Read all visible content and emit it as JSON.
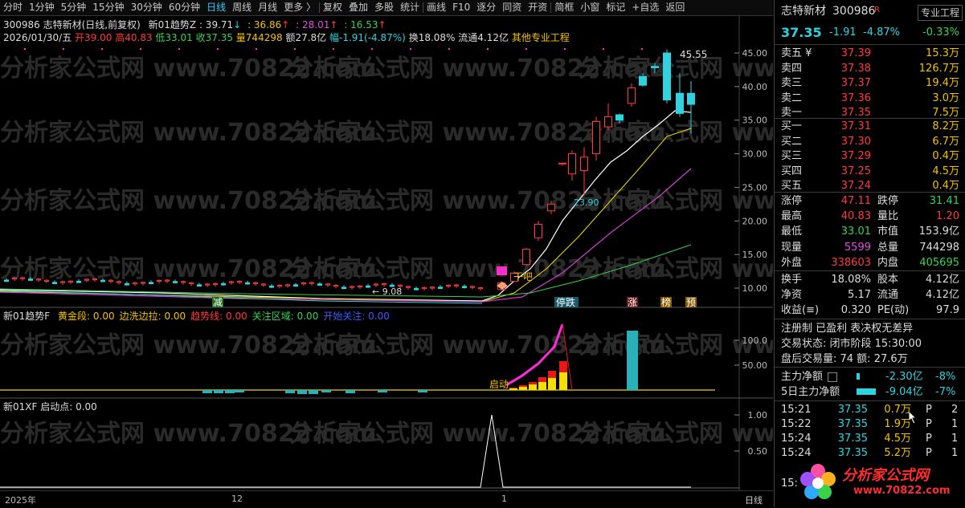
{
  "toolbar": {
    "items": [
      "分时",
      "1分钟",
      "5分钟",
      "15分钟",
      "30分钟",
      "60分钟",
      "日线",
      "周线",
      "月线",
      "更多 〉",
      "复权",
      "叠加",
      "多股",
      "统计",
      "画线",
      "F10",
      "逐分",
      "同资",
      "开资",
      "简框",
      "小窗",
      "标记",
      "+自选",
      "返回"
    ],
    "active": "日线"
  },
  "chart": {
    "header1": {
      "code_name": "300986 志特新材(日线,前复权)",
      "indicator": "新01趋势Z : 39.71",
      "v2": ": 36.86",
      "v3": ": 28.01",
      "v4": ": 16.53"
    },
    "header2": {
      "date": "2026/01/30/五",
      "open": "开39.00",
      "high": "高40.83",
      "low": "低33.01",
      "close": "收37.35",
      "vol": "量744298",
      "amount": "额27.8亿",
      "change": "幅-1.91(-4.87%)",
      "turnover": "换18.08%",
      "float": "流通4.12亿",
      "sector": "其他专业工程"
    },
    "price_axis": [
      "45.00",
      "40.00",
      "35.00",
      "30.00",
      "25.00",
      "20.00",
      "15.00",
      "10.00"
    ],
    "annotations": {
      "high_mark": "45.55",
      "low_mark": "← 9.08",
      "mid_mark": "23.90",
      "gan_label": "干吧",
      "jian_label": "减",
      "tingdie_label": "停跌",
      "zhang": "涨",
      "bang": "榜",
      "yu": "预"
    },
    "sub1": {
      "title": "新01趋势F",
      "labels": [
        {
          "text": "黄金段: 0.00",
          "color": "#f3c200"
        },
        {
          "text": "边洗边拉: 0.00",
          "color": "#f3c200"
        },
        {
          "text": "趋势线: 0.00",
          "color": "#ff3b3b"
        },
        {
          "text": "关注区域: 0.00",
          "color": "#39d353"
        },
        {
          "text": "开始关注: 0.00",
          "color": "#3c5cff"
        }
      ],
      "axis": [
        "100.0",
        "50.00"
      ],
      "start_label": "启动"
    },
    "sub2": {
      "title": "新01XF 启动点: 0.00",
      "axis": [
        "1.00",
        "0.50"
      ]
    },
    "time_axis": [
      "2025年",
      "12",
      "1"
    ],
    "period": "日线",
    "watermark": "分析家公式网 www.70822.com"
  },
  "panel": {
    "name": "志特新材",
    "code": "300986",
    "r_badge": "R",
    "pro_btn": "专业工程",
    "price": "37.35",
    "change": "-1.91",
    "pct": "-4.87%",
    "sector_pct": "-0.33%",
    "sells": [
      {
        "label": "卖五 ¥",
        "price": "37.39",
        "vol": "15.3万"
      },
      {
        "label": "卖四",
        "price": "37.38",
        "vol": "126.7万"
      },
      {
        "label": "卖三",
        "price": "37.37",
        "vol": "19.4万"
      },
      {
        "label": "卖二",
        "price": "37.36",
        "vol": "3.0万"
      },
      {
        "label": "卖一",
        "price": "37.35",
        "vol": "7.5万"
      }
    ],
    "buys": [
      {
        "label": "买一",
        "price": "37.31",
        "vol": "8.2万"
      },
      {
        "label": "买二",
        "price": "37.30",
        "vol": "6.7万"
      },
      {
        "label": "买三",
        "price": "37.29",
        "vol": "0.4万"
      },
      {
        "label": "买四",
        "price": "37.25",
        "vol": "4.5万"
      },
      {
        "label": "买五",
        "price": "37.24",
        "vol": "0.4万"
      }
    ],
    "stats1": [
      {
        "l1": "涨停",
        "v1": "47.11",
        "c1": "red",
        "l2": "跌停",
        "v2": "31.41",
        "c2": "grn"
      },
      {
        "l1": "最高",
        "v1": "40.83",
        "c1": "red",
        "l2": "量比",
        "v2": "1.20",
        "c2": "red"
      },
      {
        "l1": "最低",
        "v1": "33.01",
        "c1": "grn",
        "l2": "市值",
        "v2": "153.9亿",
        "c2": "wht"
      },
      {
        "l1": "现量",
        "v1": "5599",
        "c1": "mag",
        "l2": "总量",
        "v2": "744298",
        "c2": "wht"
      },
      {
        "l1": "外盘",
        "v1": "338603",
        "c1": "red",
        "l2": "内盘",
        "v2": "405695",
        "c2": "grn"
      }
    ],
    "stats2": [
      {
        "l1": "换手",
        "v1": "18.08%",
        "l2": "股本",
        "v2": "4.12亿"
      },
      {
        "l1": "净资",
        "v1": "5.17",
        "l2": "流通",
        "v2": "4.12亿"
      },
      {
        "l1": "收益(≡)",
        "v1": "0.320",
        "l2": "PE(动)",
        "v2": "97.9"
      }
    ],
    "info": {
      "reg": "注册制 已盈利 表决权无差异",
      "status": "交易状态: 闭市阶段 15:30:00",
      "after": "盘后交易量: 74  额: 27.6万"
    },
    "flow": [
      {
        "label": "主力净额",
        "val": "-2.30亿",
        "pct": "-8%"
      },
      {
        "label": "5日主力净额",
        "val": "-9.04亿",
        "pct": "-7%"
      }
    ],
    "ticks": [
      {
        "time": "15:21",
        "price": "37.35",
        "vol": "0.7万",
        "flag": "P",
        "n": "2"
      },
      {
        "time": "15:22",
        "price": "37.35",
        "vol": "1.9万",
        "flag": "P",
        "n": "1"
      },
      {
        "time": "15:24",
        "price": "37.35",
        "vol": "4.5万",
        "flag": "P",
        "n": "1"
      },
      {
        "time": "15:24",
        "price": "37.35",
        "vol": "5.2万",
        "flag": "P",
        "n": "1"
      }
    ],
    "ticks_extra": "15:",
    "logo_text": "分析家公式网",
    "logo_url": "www.70822.com"
  }
}
